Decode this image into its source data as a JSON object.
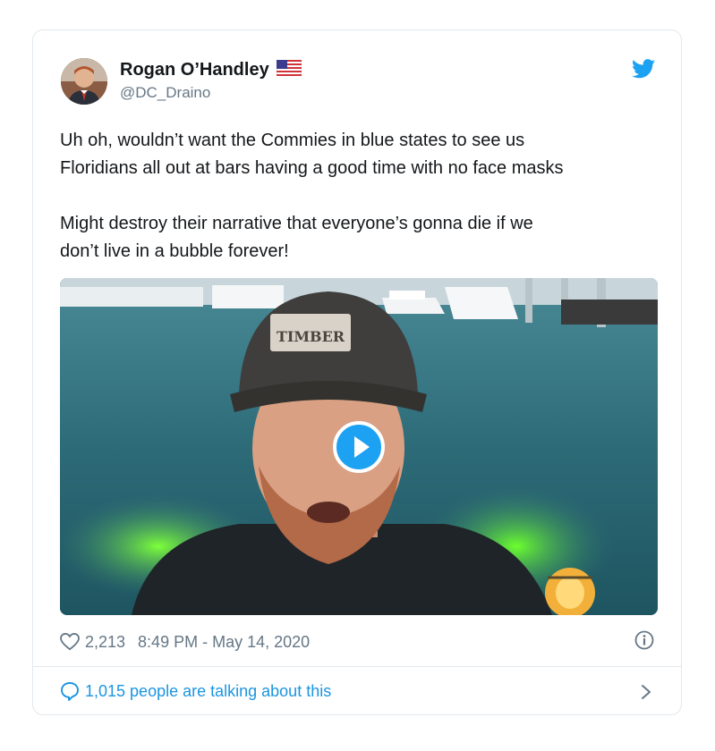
{
  "tweet": {
    "author_name": "Rogan O’Handley",
    "author_handle": "@DC_Draino",
    "text": "Uh oh, wouldn’t want the Commies in blue states to see us\nFloridians all out at bars having a good time with no face masks\n\nMight destroy their narrative that everyone’s gonna die if we\ndon’t live in a bubble forever!",
    "likes": "2,213",
    "timestamp": "8:49 PM - May 14, 2020",
    "conversation": "1,015 people are talking about this"
  },
  "media": {
    "cap_text": "TIMBER"
  },
  "colors": {
    "accent": "#1da1f2",
    "link": "#1b95e0",
    "muted": "#657786",
    "border": "#e1e8ed"
  },
  "icons": [
    "us-flag-icon",
    "twitter-bird-icon",
    "play-icon",
    "heart-icon",
    "info-icon",
    "speech-bubble-icon",
    "chevron-right-icon"
  ]
}
